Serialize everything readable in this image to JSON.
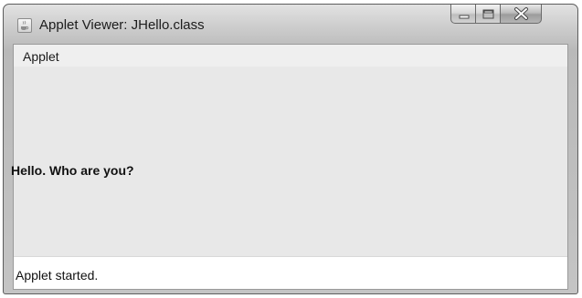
{
  "window": {
    "title": "Applet Viewer: JHello.class",
    "icon": "java-coffee-cup-icon",
    "controls": {
      "minimize_icon": "minimize-icon",
      "maximize_icon": "maximize-icon",
      "close_icon": "close-icon"
    }
  },
  "menu": {
    "applet_label": "Applet"
  },
  "applet": {
    "label_text": "Hello. Who are you?"
  },
  "status": {
    "text": "Applet started."
  }
}
